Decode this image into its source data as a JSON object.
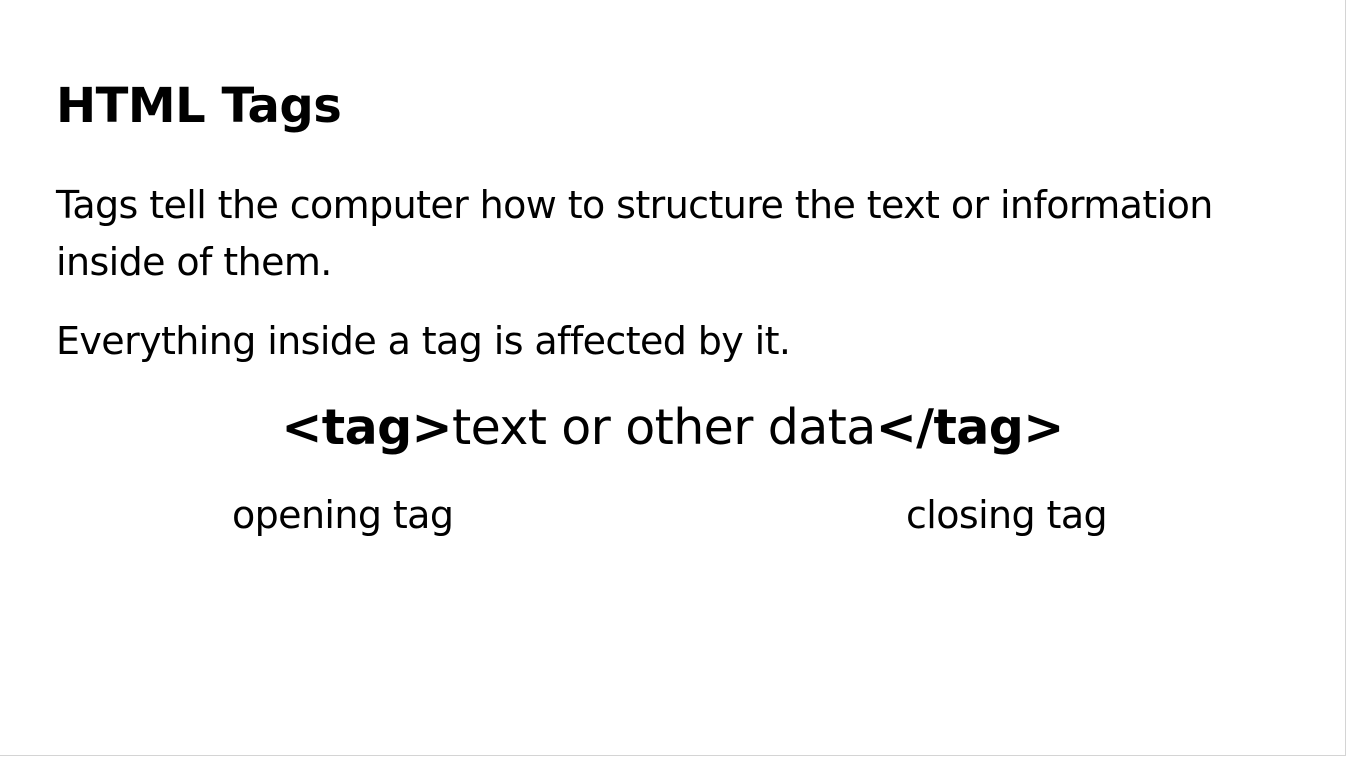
{
  "slide": {
    "title": "HTML Tags",
    "paragraphs": [
      "Tags tell the computer how to structure the text or information inside of them.",
      "Everything inside a tag is affected by it."
    ],
    "example": {
      "opening_tag": "<tag>",
      "content": "text or other data",
      "closing_tag": "</tag>"
    },
    "captions": {
      "opening": "opening tag",
      "closing": "closing tag"
    }
  }
}
